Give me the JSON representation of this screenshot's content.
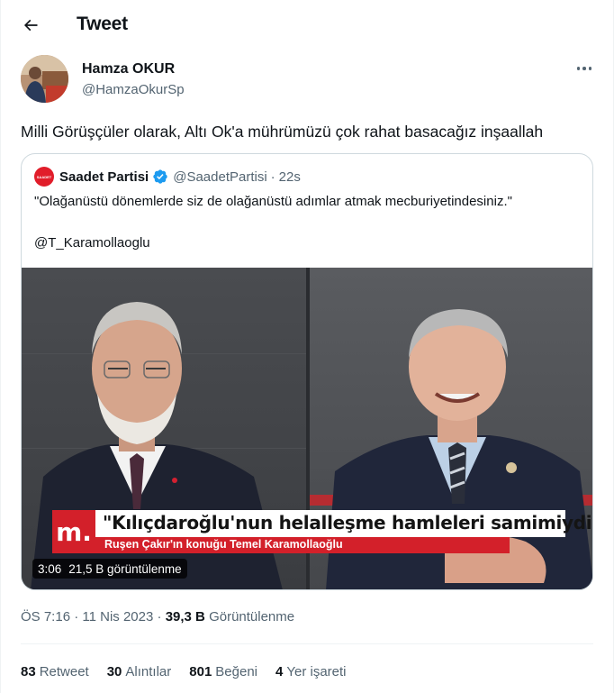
{
  "header": {
    "title": "Tweet"
  },
  "author": {
    "name": "Hamza OKUR",
    "handle": "@HamzaOkurSp"
  },
  "tweet": {
    "text": "Milli Görüşçüler olarak, Altı Ok'a mührümüzü çok rahat basacağız inşaallah"
  },
  "quote": {
    "name": "Saadet Partisi",
    "avatar_text": "SAADET",
    "handle": "@SaadetPartisi",
    "separator": "·",
    "time": "22s",
    "text_line1": "\"Olağanüstü dönemlerde siz de olağanüstü adımlar atmak mecburiyetindesiniz.\"",
    "text_line2": "@T_Karamollaoglu",
    "video": {
      "logo": "m.",
      "headline": "\"Kılıçdaroğlu'nun helalleşme hamleleri samimiydi\"",
      "subline": "Ruşen Çakır'ın konuğu Temel Karamollaoğlu",
      "duration": "3:06",
      "views": "21,5 B görüntülenme"
    }
  },
  "meta": {
    "time": "ÖS 7:16",
    "dot": "·",
    "date": "11 Nis 2023",
    "dot2": "·",
    "views_count": "39,3 B",
    "views_label": "Görüntülenme"
  },
  "stats": {
    "retweets_count": "83",
    "retweets_label": "Retweet",
    "quotes_count": "30",
    "quotes_label": "Alıntılar",
    "likes_count": "801",
    "likes_label": "Beğeni",
    "bookmarks_count": "4",
    "bookmarks_label": "Yer işareti"
  },
  "colors": {
    "accent": "#1d9bf0",
    "brand_red": "#d3202a",
    "muted": "#536471"
  }
}
